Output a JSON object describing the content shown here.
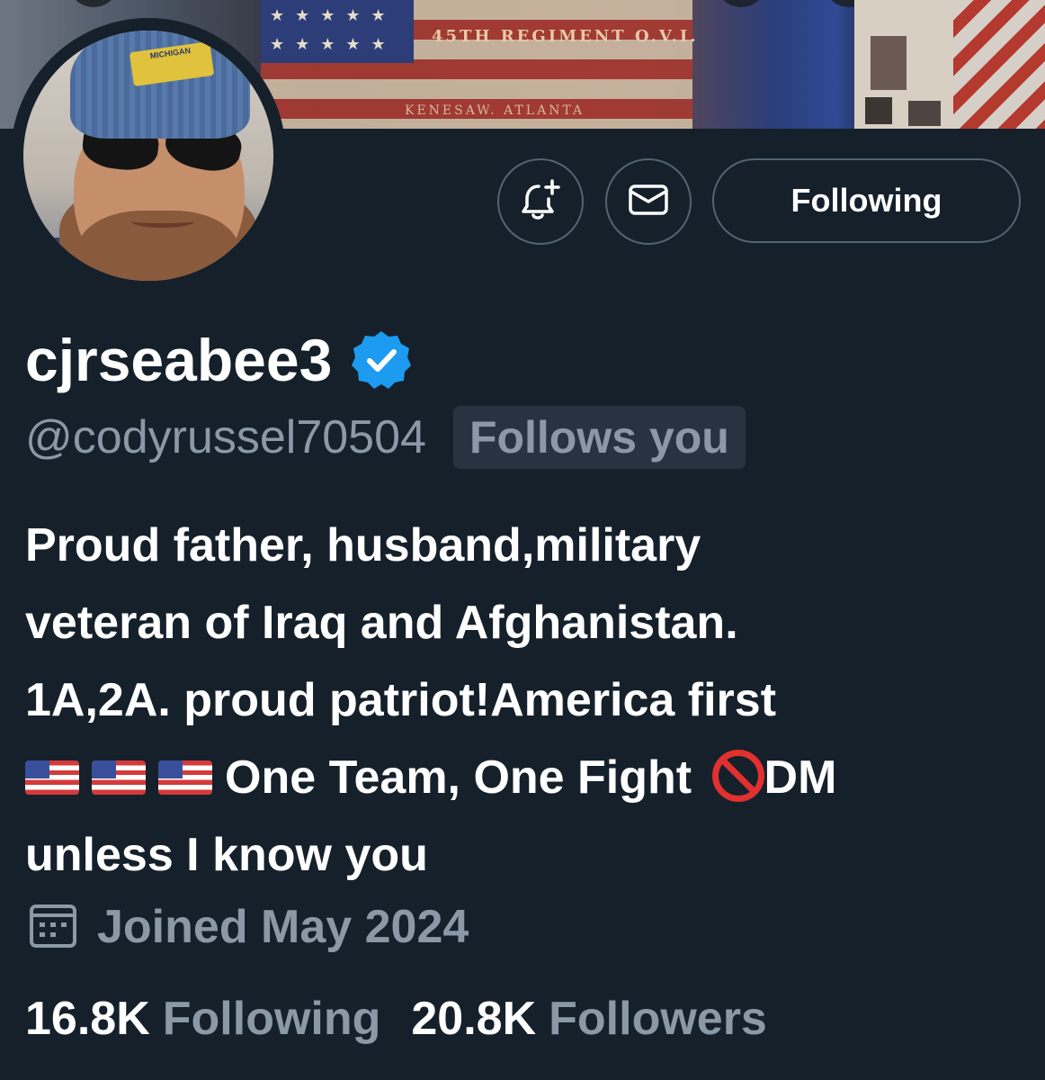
{
  "banner": {
    "flag_text": "45TH REGIMENT O.V.I.",
    "flag_subtext": "KENESAW. ATLANTA"
  },
  "avatar": {
    "hat_text": "MICHIGAN"
  },
  "actions": {
    "notify_icon": "bell-plus-icon",
    "message_icon": "envelope-icon",
    "following_label": "Following"
  },
  "profile": {
    "display_name": "cjrseabee3",
    "verified_icon": "verified-badge-icon",
    "handle": "@codyrussel70504",
    "follows_you": "Follows you",
    "bio": {
      "line1": "Proud father, husband,military",
      "line2": "veteran of Iraq and Afghanistan.",
      "line3": "1A,2A. proud patriot!America first",
      "line4_text": "One Team, One Fight",
      "line4_end": "DM",
      "line5": "unless I know you"
    },
    "joined": "Joined May 2024",
    "joined_icon": "calendar-icon"
  },
  "stats": {
    "following_count": "16.8K",
    "following_label": "Following",
    "followers_count": "20.8K",
    "followers_label": "Followers"
  },
  "colors": {
    "background": "#15202b",
    "secondary_text": "#8b98a5",
    "verified_blue": "#1d9bf0",
    "border": "#536471"
  }
}
